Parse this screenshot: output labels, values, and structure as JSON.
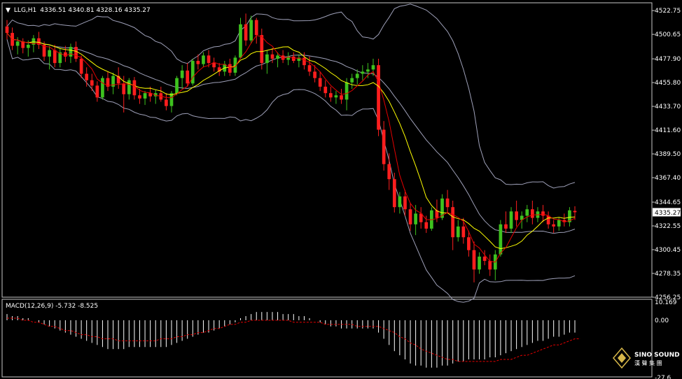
{
  "colors": {
    "background": "#000000",
    "frame": "#c8c8c8",
    "text": "#ffffff",
    "bull": "#3ec21e",
    "bear": "#ff1e1e",
    "band": "#9ea0b8",
    "ma_fast": "#e60000",
    "ma_slow": "#ffff00",
    "macd_hist": "#ffffff",
    "macd_signal": "#e60000"
  },
  "chart_data": [
    {
      "type": "candlestick",
      "header_prefix": "▼",
      "symbol": "LLG,H1",
      "ohlc_header": "4336.51 4340.81 4328.16 4335.27",
      "current_price_label": "4335.27",
      "ylim": [
        4256.25,
        4530
      ],
      "y_ticks": [
        "4522.75",
        "4500.65",
        "4477.90",
        "4455.80",
        "4433.70",
        "4411.60",
        "4389.50",
        "4367.40",
        "4344.65",
        "4322.55",
        "4300.45",
        "4278.35",
        "4256.25"
      ],
      "candles": [
        [
          4508,
          4514,
          4496,
          4502
        ],
        [
          4502,
          4507,
          4486,
          4490
        ],
        [
          4490,
          4498,
          4482,
          4494
        ],
        [
          4494,
          4497,
          4483,
          4488
        ],
        [
          4488,
          4495,
          4480,
          4491
        ],
        [
          4491,
          4500,
          4484,
          4497
        ],
        [
          4497,
          4503,
          4487,
          4491
        ],
        [
          4491,
          4494,
          4476,
          4480
        ],
        [
          4480,
          4490,
          4468,
          4486
        ],
        [
          4486,
          4491,
          4470,
          4474
        ],
        [
          4474,
          4488,
          4470,
          4484
        ],
        [
          4484,
          4490,
          4475,
          4480
        ],
        [
          4480,
          4492,
          4474,
          4489
        ],
        [
          4489,
          4494,
          4475,
          4478
        ],
        [
          4478,
          4481,
          4460,
          4464
        ],
        [
          4464,
          4470,
          4452,
          4458
        ],
        [
          4458,
          4464,
          4448,
          4453
        ],
        [
          4453,
          4457,
          4438,
          4442
        ],
        [
          4442,
          4462,
          4440,
          4460
        ],
        [
          4460,
          4466,
          4448,
          4452
        ],
        [
          4452,
          4465,
          4445,
          4462
        ],
        [
          4462,
          4470,
          4450,
          4455
        ],
        [
          4455,
          4462,
          4428,
          4445
        ],
        [
          4445,
          4460,
          4440,
          4458
        ],
        [
          4458,
          4461,
          4440,
          4444
        ],
        [
          4444,
          4450,
          4436,
          4441
        ],
        [
          4441,
          4448,
          4435,
          4446
        ],
        [
          4446,
          4452,
          4438,
          4443
        ],
        [
          4443,
          4449,
          4436,
          4446
        ],
        [
          4446,
          4452,
          4438,
          4440
        ],
        [
          4440,
          4446,
          4430,
          4434
        ],
        [
          4434,
          4448,
          4428,
          4446
        ],
        [
          4446,
          4462,
          4444,
          4460
        ],
        [
          4460,
          4472,
          4450,
          4467
        ],
        [
          4467,
          4474,
          4452,
          4455
        ],
        [
          4455,
          4478,
          4453,
          4476
        ],
        [
          4476,
          4482,
          4468,
          4473
        ],
        [
          4473,
          4484,
          4470,
          4481
        ],
        [
          4481,
          4486,
          4470,
          4474
        ],
        [
          4474,
          4479,
          4466,
          4470
        ],
        [
          4470,
          4474,
          4462,
          4466
        ],
        [
          4466,
          4476,
          4462,
          4473
        ],
        [
          4473,
          4478,
          4462,
          4465
        ],
        [
          4465,
          4481,
          4462,
          4479
        ],
        [
          4479,
          4516,
          4478,
          4510
        ],
        [
          4510,
          4520,
          4490,
          4495
        ],
        [
          4495,
          4518,
          4492,
          4514
        ],
        [
          4514,
          4516,
          4492,
          4500
        ],
        [
          4500,
          4506,
          4468,
          4474
        ],
        [
          4474,
          4486,
          4464,
          4482
        ],
        [
          4482,
          4488,
          4474,
          4478
        ],
        [
          4478,
          4484,
          4470,
          4481
        ],
        [
          4481,
          4486,
          4474,
          4477
        ],
        [
          4477,
          4484,
          4472,
          4480
        ],
        [
          4480,
          4484,
          4474,
          4476
        ],
        [
          4476,
          4482,
          4470,
          4479
        ],
        [
          4479,
          4484,
          4468,
          4472
        ],
        [
          4472,
          4480,
          4462,
          4466
        ],
        [
          4466,
          4472,
          4456,
          4460
        ],
        [
          4460,
          4466,
          4448,
          4452
        ],
        [
          4452,
          4458,
          4442,
          4446
        ],
        [
          4446,
          4452,
          4438,
          4442
        ],
        [
          4442,
          4448,
          4436,
          4444
        ],
        [
          4444,
          4450,
          4436,
          4440
        ],
        [
          4440,
          4460,
          4430,
          4456
        ],
        [
          4456,
          4464,
          4450,
          4460
        ],
        [
          4460,
          4468,
          4454,
          4464
        ],
        [
          4464,
          4472,
          4458,
          4466
        ],
        [
          4466,
          4474,
          4460,
          4468
        ],
        [
          4468,
          4478,
          4462,
          4472
        ],
        [
          4472,
          4478,
          4406,
          4412
        ],
        [
          4412,
          4420,
          4374,
          4380
        ],
        [
          4380,
          4390,
          4356,
          4366
        ],
        [
          4366,
          4372,
          4335,
          4340
        ],
        [
          4340,
          4354,
          4334,
          4350
        ],
        [
          4350,
          4356,
          4332,
          4338
        ],
        [
          4338,
          4344,
          4318,
          4324
        ],
        [
          4324,
          4342,
          4314,
          4334
        ],
        [
          4334,
          4340,
          4320,
          4326
        ],
        [
          4326,
          4332,
          4316,
          4320
        ],
        [
          4320,
          4340,
          4318,
          4337
        ],
        [
          4337,
          4347,
          4326,
          4330
        ],
        [
          4330,
          4352,
          4328,
          4348
        ],
        [
          4348,
          4356,
          4334,
          4340
        ],
        [
          4340,
          4346,
          4300,
          4312
        ],
        [
          4312,
          4328,
          4308,
          4322
        ],
        [
          4322,
          4330,
          4306,
          4312
        ],
        [
          4312,
          4318,
          4294,
          4300
        ],
        [
          4300,
          4308,
          4270,
          4282
        ],
        [
          4282,
          4298,
          4278,
          4294
        ],
        [
          4294,
          4300,
          4286,
          4290
        ],
        [
          4290,
          4296,
          4276,
          4282
        ],
        [
          4282,
          4300,
          4272,
          4296
        ],
        [
          4296,
          4328,
          4294,
          4324
        ],
        [
          4324,
          4336,
          4316,
          4320
        ],
        [
          4320,
          4340,
          4316,
          4336
        ],
        [
          4336,
          4346,
          4322,
          4328
        ],
        [
          4328,
          4336,
          4320,
          4332
        ],
        [
          4332,
          4342,
          4326,
          4338
        ],
        [
          4338,
          4346,
          4324,
          4330
        ],
        [
          4330,
          4340,
          4326,
          4336
        ],
        [
          4336,
          4342,
          4326,
          4332
        ],
        [
          4332,
          4336,
          4320,
          4324
        ],
        [
          4324,
          4328,
          4316,
          4322
        ],
        [
          4322,
          4330,
          4318,
          4328
        ],
        [
          4328,
          4334,
          4322,
          4326
        ],
        [
          4326,
          4340,
          4322,
          4337
        ],
        [
          4336.51,
          4340.81,
          4328.16,
          4335.27
        ]
      ]
    },
    {
      "type": "bar",
      "title": "MACD(12,26,9) -5.732 -8.525",
      "ylim": [
        -27.5,
        10.169
      ],
      "y_ticks": [
        "10.169",
        "0.00"
      ],
      "y_tick_partial": "-27.6",
      "macd": [
        3,
        2,
        2,
        1,
        1,
        0,
        -1,
        -2,
        -3,
        -4,
        -5,
        -6,
        -7,
        -8,
        -9,
        -10,
        -11,
        -12,
        -13,
        -14,
        -14,
        -14,
        -14,
        -13,
        -13,
        -13,
        -13,
        -13,
        -13,
        -13,
        -13,
        -12,
        -11,
        -10,
        -9,
        -8,
        -7,
        -6,
        -6,
        -5,
        -4,
        -3,
        -2,
        -1,
        1,
        2,
        3,
        4,
        4,
        4,
        4,
        4,
        3,
        3,
        3,
        2,
        2,
        1,
        0,
        -1,
        -2,
        -3,
        -3,
        -4,
        -4,
        -4,
        -4,
        -4,
        -4,
        -4,
        -6,
        -9,
        -12,
        -15,
        -17,
        -19,
        -21,
        -22,
        -22,
        -23,
        -23,
        -23,
        -22,
        -22,
        -21,
        -20,
        -20,
        -19,
        -19,
        -19,
        -19,
        -18,
        -18,
        -17,
        -16,
        -15,
        -14,
        -13,
        -12,
        -11,
        -10,
        -10,
        -9,
        -8,
        -8,
        -7,
        -6,
        -6
      ],
      "signal": [
        1,
        1,
        1,
        0,
        0,
        -1,
        -1,
        -2,
        -3,
        -3,
        -4,
        -5,
        -5,
        -6,
        -7,
        -7,
        -8,
        -8,
        -9,
        -9,
        -9,
        -10,
        -10,
        -10,
        -10,
        -10,
        -10,
        -10,
        -10,
        -9,
        -9,
        -9,
        -8,
        -8,
        -7,
        -7,
        -6,
        -6,
        -5,
        -4,
        -4,
        -3,
        -2,
        -2,
        -1,
        -1,
        0,
        0,
        0,
        0,
        0,
        0,
        0,
        0,
        -1,
        -1,
        -1,
        -1,
        -1,
        -1,
        -2,
        -2,
        -2,
        -2,
        -2,
        -2,
        -3,
        -3,
        -3,
        -3,
        -3,
        -4,
        -5,
        -6,
        -8,
        -9,
        -11,
        -12,
        -14,
        -15,
        -16,
        -17,
        -18,
        -19,
        -19,
        -20,
        -20,
        -20,
        -20,
        -20,
        -20,
        -20,
        -20,
        -19,
        -19,
        -19,
        -18,
        -17,
        -17,
        -16,
        -15,
        -14,
        -13,
        -12,
        -12,
        -11,
        -10,
        -9,
        -9
      ]
    }
  ],
  "logo": {
    "brand": "SINO SOUND",
    "sub": "漢 聲 集 團"
  }
}
